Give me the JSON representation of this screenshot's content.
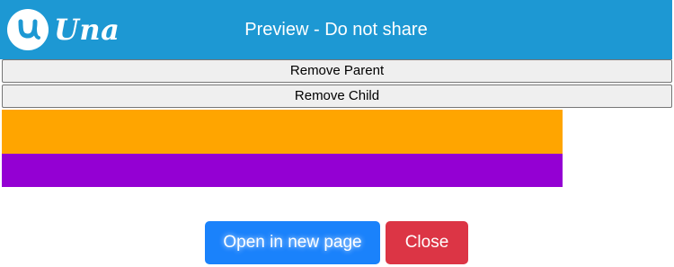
{
  "header": {
    "logo_text": "Una",
    "logo_icon": "una-u-logo-icon",
    "title": "Preview - Do not share",
    "background_color": "#1d98d3"
  },
  "actions": {
    "remove_parent_label": "Remove Parent",
    "remove_child_label": "Remove Child"
  },
  "blocks": {
    "parent_color": "#ffa500",
    "child_color": "#9400d3"
  },
  "footer": {
    "open_label": "Open in new page",
    "open_color": "#1a82fb",
    "close_label": "Close",
    "close_color": "#dc3545"
  }
}
